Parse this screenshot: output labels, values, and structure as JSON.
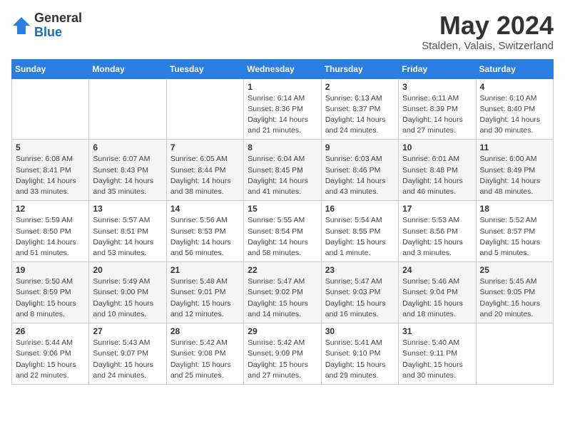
{
  "header": {
    "logo_line1": "General",
    "logo_line2": "Blue",
    "month_title": "May 2024",
    "subtitle": "Stalden, Valais, Switzerland"
  },
  "days_of_week": [
    "Sunday",
    "Monday",
    "Tuesday",
    "Wednesday",
    "Thursday",
    "Friday",
    "Saturday"
  ],
  "weeks": [
    [
      {
        "day": "",
        "info": ""
      },
      {
        "day": "",
        "info": ""
      },
      {
        "day": "",
        "info": ""
      },
      {
        "day": "1",
        "info": "Sunrise: 6:14 AM\nSunset: 8:36 PM\nDaylight: 14 hours\nand 21 minutes."
      },
      {
        "day": "2",
        "info": "Sunrise: 6:13 AM\nSunset: 8:37 PM\nDaylight: 14 hours\nand 24 minutes."
      },
      {
        "day": "3",
        "info": "Sunrise: 6:11 AM\nSunset: 8:39 PM\nDaylight: 14 hours\nand 27 minutes."
      },
      {
        "day": "4",
        "info": "Sunrise: 6:10 AM\nSunset: 8:40 PM\nDaylight: 14 hours\nand 30 minutes."
      }
    ],
    [
      {
        "day": "5",
        "info": "Sunrise: 6:08 AM\nSunset: 8:41 PM\nDaylight: 14 hours\nand 33 minutes."
      },
      {
        "day": "6",
        "info": "Sunrise: 6:07 AM\nSunset: 8:43 PM\nDaylight: 14 hours\nand 35 minutes."
      },
      {
        "day": "7",
        "info": "Sunrise: 6:05 AM\nSunset: 8:44 PM\nDaylight: 14 hours\nand 38 minutes."
      },
      {
        "day": "8",
        "info": "Sunrise: 6:04 AM\nSunset: 8:45 PM\nDaylight: 14 hours\nand 41 minutes."
      },
      {
        "day": "9",
        "info": "Sunrise: 6:03 AM\nSunset: 8:46 PM\nDaylight: 14 hours\nand 43 minutes."
      },
      {
        "day": "10",
        "info": "Sunrise: 6:01 AM\nSunset: 8:48 PM\nDaylight: 14 hours\nand 46 minutes."
      },
      {
        "day": "11",
        "info": "Sunrise: 6:00 AM\nSunset: 8:49 PM\nDaylight: 14 hours\nand 48 minutes."
      }
    ],
    [
      {
        "day": "12",
        "info": "Sunrise: 5:59 AM\nSunset: 8:50 PM\nDaylight: 14 hours\nand 51 minutes."
      },
      {
        "day": "13",
        "info": "Sunrise: 5:57 AM\nSunset: 8:51 PM\nDaylight: 14 hours\nand 53 minutes."
      },
      {
        "day": "14",
        "info": "Sunrise: 5:56 AM\nSunset: 8:53 PM\nDaylight: 14 hours\nand 56 minutes."
      },
      {
        "day": "15",
        "info": "Sunrise: 5:55 AM\nSunset: 8:54 PM\nDaylight: 14 hours\nand 58 minutes."
      },
      {
        "day": "16",
        "info": "Sunrise: 5:54 AM\nSunset: 8:55 PM\nDaylight: 15 hours\nand 1 minute."
      },
      {
        "day": "17",
        "info": "Sunrise: 5:53 AM\nSunset: 8:56 PM\nDaylight: 15 hours\nand 3 minutes."
      },
      {
        "day": "18",
        "info": "Sunrise: 5:52 AM\nSunset: 8:57 PM\nDaylight: 15 hours\nand 5 minutes."
      }
    ],
    [
      {
        "day": "19",
        "info": "Sunrise: 5:50 AM\nSunset: 8:59 PM\nDaylight: 15 hours\nand 8 minutes."
      },
      {
        "day": "20",
        "info": "Sunrise: 5:49 AM\nSunset: 9:00 PM\nDaylight: 15 hours\nand 10 minutes."
      },
      {
        "day": "21",
        "info": "Sunrise: 5:48 AM\nSunset: 9:01 PM\nDaylight: 15 hours\nand 12 minutes."
      },
      {
        "day": "22",
        "info": "Sunrise: 5:47 AM\nSunset: 9:02 PM\nDaylight: 15 hours\nand 14 minutes."
      },
      {
        "day": "23",
        "info": "Sunrise: 5:47 AM\nSunset: 9:03 PM\nDaylight: 15 hours\nand 16 minutes."
      },
      {
        "day": "24",
        "info": "Sunrise: 5:46 AM\nSunset: 9:04 PM\nDaylight: 15 hours\nand 18 minutes."
      },
      {
        "day": "25",
        "info": "Sunrise: 5:45 AM\nSunset: 9:05 PM\nDaylight: 15 hours\nand 20 minutes."
      }
    ],
    [
      {
        "day": "26",
        "info": "Sunrise: 5:44 AM\nSunset: 9:06 PM\nDaylight: 15 hours\nand 22 minutes."
      },
      {
        "day": "27",
        "info": "Sunrise: 5:43 AM\nSunset: 9:07 PM\nDaylight: 15 hours\nand 24 minutes."
      },
      {
        "day": "28",
        "info": "Sunrise: 5:42 AM\nSunset: 9:08 PM\nDaylight: 15 hours\nand 25 minutes."
      },
      {
        "day": "29",
        "info": "Sunrise: 5:42 AM\nSunset: 9:09 PM\nDaylight: 15 hours\nand 27 minutes."
      },
      {
        "day": "30",
        "info": "Sunrise: 5:41 AM\nSunset: 9:10 PM\nDaylight: 15 hours\nand 29 minutes."
      },
      {
        "day": "31",
        "info": "Sunrise: 5:40 AM\nSunset: 9:11 PM\nDaylight: 15 hours\nand 30 minutes."
      },
      {
        "day": "",
        "info": ""
      }
    ]
  ]
}
